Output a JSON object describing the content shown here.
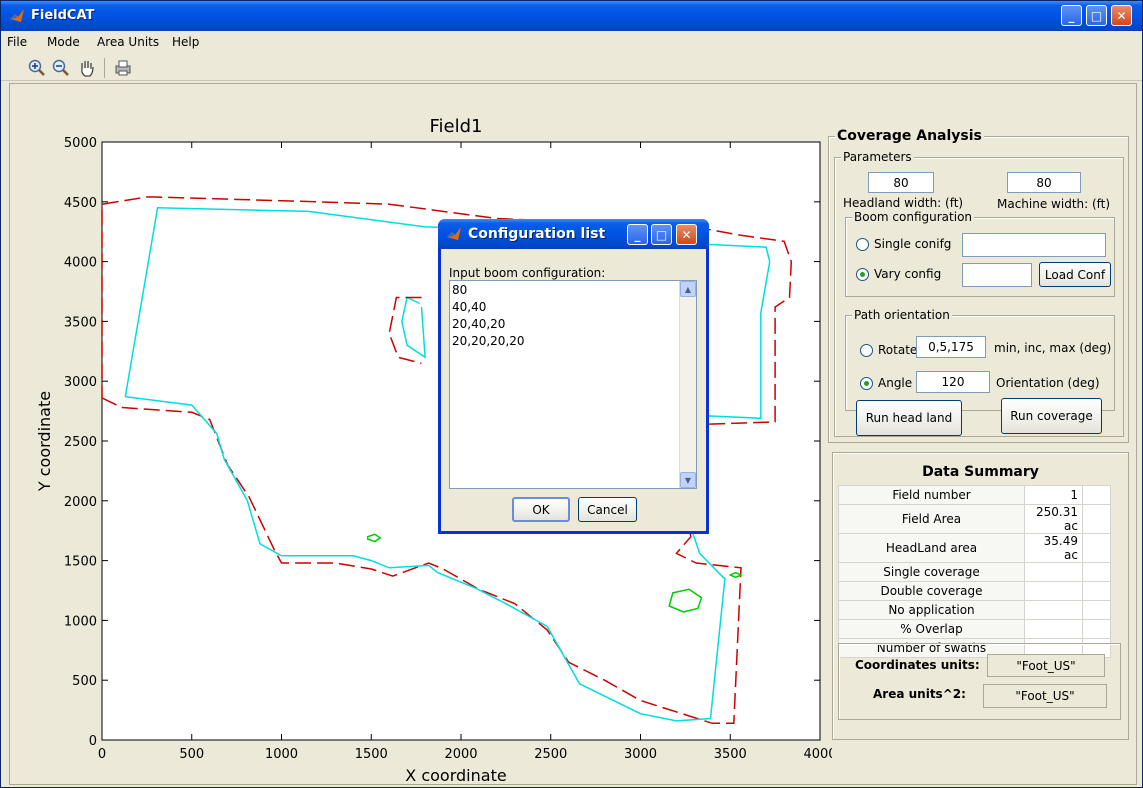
{
  "app": {
    "title": "FieldCAT"
  },
  "window_controls": {
    "minimize": "_",
    "maximize": "□",
    "close": "✕"
  },
  "menu": [
    "File",
    "Mode",
    "Area Units",
    "Help"
  ],
  "toolbar_icons": [
    "zoom-in-icon",
    "zoom-out-icon",
    "pan-hand-icon",
    "print-icon"
  ],
  "chart_data": {
    "type": "line",
    "title": "Field1",
    "xlabel": "X coordinate",
    "ylabel": "Y coordinate",
    "xlim": [
      0,
      4000
    ],
    "ylim": [
      0,
      5000
    ],
    "xticks": [
      "0",
      "500",
      "1000",
      "1500",
      "2000",
      "2500",
      "3000",
      "3500",
      "4000"
    ],
    "yticks": [
      "0",
      "500",
      "1000",
      "1500",
      "2000",
      "2500",
      "3000",
      "3500",
      "4000",
      "4500",
      "5000"
    ],
    "grid": false,
    "series": [
      {
        "color": "#cc0000",
        "style": "dashed",
        "points": [
          [
            0,
            2860
          ],
          [
            110,
            2780
          ],
          [
            500,
            2740
          ],
          [
            600,
            2680
          ],
          [
            700,
            2300
          ],
          [
            820,
            2030
          ],
          [
            960,
            1590
          ],
          [
            1000,
            1480
          ],
          [
            1300,
            1480
          ],
          [
            1500,
            1430
          ],
          [
            1620,
            1370
          ],
          [
            1820,
            1480
          ],
          [
            1900,
            1430
          ],
          [
            2100,
            1260
          ],
          [
            2300,
            1140
          ],
          [
            2480,
            920
          ],
          [
            2600,
            650
          ],
          [
            2800,
            500
          ],
          [
            3000,
            330
          ],
          [
            3400,
            140
          ],
          [
            3520,
            140
          ],
          [
            3560,
            1440
          ],
          [
            3310,
            1480
          ],
          [
            3200,
            1560
          ],
          [
            3280,
            1700
          ],
          [
            3240,
            2010
          ],
          [
            3290,
            2300
          ],
          [
            3350,
            2640
          ],
          [
            3750,
            2660
          ],
          [
            3750,
            3620
          ],
          [
            3830,
            3700
          ],
          [
            3840,
            4000
          ],
          [
            3800,
            4170
          ],
          [
            3560,
            4220
          ],
          [
            3300,
            4290
          ],
          [
            2200,
            4360
          ],
          [
            1600,
            4480
          ],
          [
            1200,
            4500
          ],
          [
            300,
            4540
          ],
          [
            250,
            4540
          ],
          [
            0,
            4480
          ]
        ],
        "closed": true
      },
      {
        "color": "#00dede",
        "style": "solid",
        "points": [
          [
            130,
            2870
          ],
          [
            310,
            4450
          ],
          [
            1150,
            4420
          ],
          [
            1800,
            4290
          ],
          [
            2200,
            4270
          ],
          [
            2500,
            4220
          ],
          [
            3300,
            4150
          ],
          [
            3700,
            4120
          ],
          [
            3720,
            4000
          ],
          [
            3670,
            3570
          ],
          [
            3670,
            2690
          ],
          [
            3380,
            2710
          ],
          [
            3300,
            2340
          ],
          [
            3220,
            2040
          ],
          [
            3330,
            1560
          ],
          [
            3460,
            1360
          ],
          [
            3470,
            1350
          ],
          [
            3390,
            180
          ],
          [
            3200,
            160
          ],
          [
            3000,
            220
          ],
          [
            2660,
            470
          ],
          [
            2480,
            950
          ],
          [
            2250,
            1140
          ],
          [
            2080,
            1270
          ],
          [
            1870,
            1400
          ],
          [
            1820,
            1460
          ],
          [
            1600,
            1440
          ],
          [
            1500,
            1500
          ],
          [
            1400,
            1540
          ],
          [
            1000,
            1540
          ],
          [
            880,
            1640
          ],
          [
            810,
            2000
          ],
          [
            680,
            2350
          ],
          [
            640,
            2560
          ],
          [
            500,
            2800
          ],
          [
            130,
            2870
          ]
        ],
        "closed": false
      },
      {
        "color": "#00dede",
        "style": "solid",
        "points": [
          [
            1770,
            3650
          ],
          [
            1700,
            3700
          ],
          [
            1670,
            3500
          ],
          [
            1700,
            3300
          ],
          [
            1800,
            3200
          ],
          [
            1780,
            3620
          ]
        ],
        "closed": false
      },
      {
        "color": "#cc0000",
        "style": "dashed",
        "points": [
          [
            1780,
            3700
          ],
          [
            1640,
            3700
          ],
          [
            1600,
            3400
          ],
          [
            1650,
            3200
          ],
          [
            1780,
            3150
          ]
        ],
        "closed": false
      },
      {
        "color": "#00cc00",
        "style": "solid",
        "points": [
          [
            1480,
            1700
          ],
          [
            1520,
            1720
          ],
          [
            1550,
            1690
          ],
          [
            1520,
            1660
          ],
          [
            1480,
            1680
          ]
        ],
        "closed": true
      },
      {
        "color": "#00cc00",
        "style": "solid",
        "points": [
          [
            3180,
            1230
          ],
          [
            3270,
            1260
          ],
          [
            3340,
            1190
          ],
          [
            3320,
            1100
          ],
          [
            3240,
            1070
          ],
          [
            3160,
            1120
          ]
        ],
        "closed": true
      },
      {
        "color": "#00cc00",
        "style": "solid",
        "points": [
          [
            3500,
            1380
          ],
          [
            3530,
            1400
          ],
          [
            3560,
            1380
          ],
          [
            3530,
            1360
          ]
        ],
        "closed": true
      }
    ]
  },
  "coverage": {
    "title": "Coverage Analysis",
    "parameters_title": "Parameters",
    "headland_width": "80",
    "headland_label": "Headland width: (ft)",
    "machine_width": "80",
    "machine_label": "Machine width: (ft)",
    "boom_title": "Boom configuration",
    "single_label": "Single conifg",
    "single_value": "",
    "vary_label": "Vary config",
    "vary_value": "",
    "load_conf": "Load Conf",
    "path_title": "Path orientation",
    "rotate_label": "Rotate",
    "rotate_value": "0,5,175",
    "rotate_hint": "min, inc, max (deg)",
    "angle_label": "Angle",
    "angle_value": "120",
    "angle_hint": "Orientation (deg)",
    "run_head_land": "Run head land",
    "run_coverage": "Run coverage"
  },
  "summary": {
    "title": "Data Summary",
    "rows": [
      {
        "name": "Field number",
        "value": "1"
      },
      {
        "name": "Field Area",
        "value": "250.31 ac"
      },
      {
        "name": "HeadLand area",
        "value": "35.49 ac"
      },
      {
        "name": "Single coverage",
        "value": ""
      },
      {
        "name": "Double coverage",
        "value": ""
      },
      {
        "name": "No application",
        "value": ""
      },
      {
        "name": "% Overlap",
        "value": ""
      },
      {
        "name": "Number of swaths",
        "value": ""
      }
    ]
  },
  "units": {
    "coord_label": "Coordinates units:",
    "coord_value": "\"Foot_US\"",
    "area_label": "Area units^2:",
    "area_value": "\"Foot_US\""
  },
  "dialog": {
    "title": "Configuration list",
    "prompt": "Input boom configuration:",
    "lines": [
      "80",
      "40,40",
      "20,40,20",
      "20,20,20,20"
    ],
    "ok": "OK",
    "cancel": "Cancel"
  }
}
